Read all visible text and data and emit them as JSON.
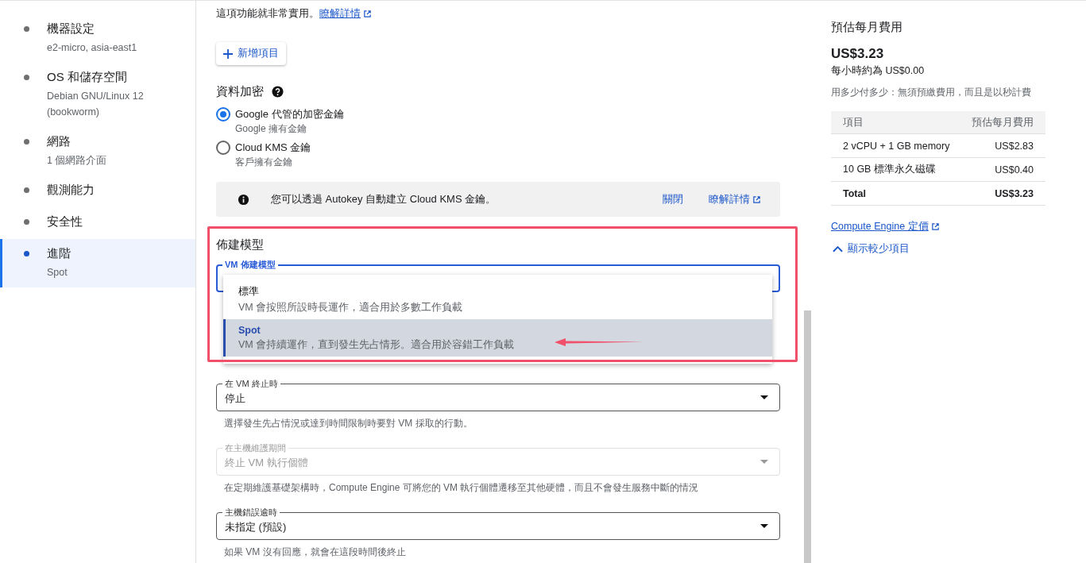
{
  "sidebar": {
    "items": [
      {
        "title": "機器設定",
        "subtitle": "e2-micro, asia-east1",
        "selected": false
      },
      {
        "title": "OS 和儲存空間",
        "subtitle": "Debian GNU/Linux 12 (bookworm)",
        "selected": false
      },
      {
        "title": "網路",
        "subtitle": "1 個網路介面",
        "selected": false
      },
      {
        "title": "觀測能力",
        "selected": false
      },
      {
        "title": "安全性",
        "selected": false
      },
      {
        "title": "進階",
        "subtitle": "Spot",
        "selected": true
      }
    ]
  },
  "intro": {
    "text": "這項功能就非常實用。",
    "link": "瞭解詳情"
  },
  "add_button": {
    "label": "新增項目"
  },
  "encryption": {
    "title": "資料加密",
    "options": [
      {
        "label": "Google 代管的加密金鑰",
        "description": "Google 擁有金鑰",
        "selected": true
      },
      {
        "label": "Cloud KMS 金鑰",
        "description": "客戶擁有金鑰",
        "selected": false
      }
    ],
    "notice": {
      "text": "您可以透過 Autokey 自動建立 Cloud KMS 金鑰。",
      "dismiss": "關閉",
      "link": "瞭解詳情"
    }
  },
  "provisioning": {
    "title": "佈建模型",
    "field_label": "VM 佈建模型",
    "menu": [
      {
        "title": "標準",
        "description": "VM 會按照所設時長運作，適合用於多數工作負載",
        "selected": false
      },
      {
        "title": "Spot",
        "description": "VM 會持續運作，直到發生先占情形。適合用於容錯工作負載",
        "selected": true
      }
    ]
  },
  "fields": [
    {
      "label": "在 VM 終止時",
      "value": "停止",
      "helper": "選擇發生先占情況或達到時間限制時要對 VM 採取的行動。",
      "disabled": false
    },
    {
      "label": "在主機維護期間",
      "value": "終止 VM 執行個體",
      "helper": "在定期維護基礎架構時，Compute Engine 可將您的 VM 執行個體遷移至其他硬體，而且不會發生服務中斷的情況",
      "disabled": true
    },
    {
      "label": "主機錯誤逾時",
      "value": "未指定 (預設)",
      "helper": "如果 VM 沒有回應，就會在這段時間後終止",
      "disabled": false
    }
  ],
  "cost": {
    "title": "預估每月費用",
    "amount": "US$3.23",
    "hourly": "每小時約為 US$0.00",
    "note": "用多少付多少：無須預繳費用，而且是以秒計費",
    "columns": [
      "項目",
      "預估每月費用"
    ],
    "rows": [
      {
        "item": "2 vCPU + 1 GB memory",
        "cost": "US$2.83",
        "kind": "line"
      },
      {
        "item": "10 GB 標準永久磁碟",
        "cost": "US$0.40",
        "kind": "line"
      },
      {
        "item": "Total",
        "cost": "US$3.23",
        "kind": "total"
      }
    ],
    "pricing_link": "Compute Engine 定價",
    "toggle": "顯示較少項目"
  }
}
